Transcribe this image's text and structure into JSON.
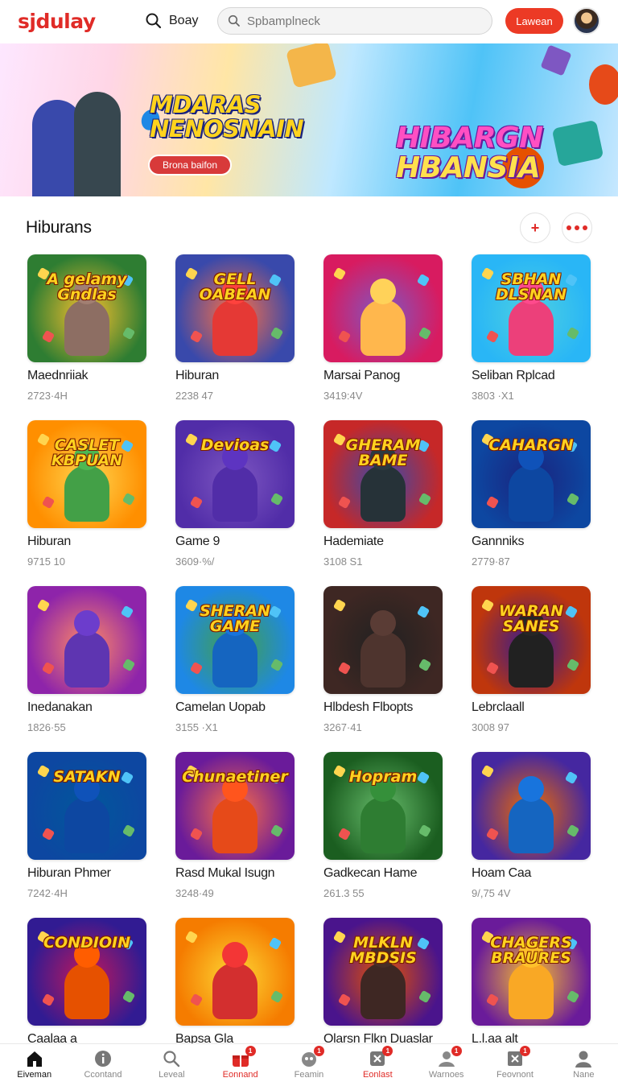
{
  "header": {
    "logo": "sjdulay",
    "search_toggle_label": "Boay",
    "search_placeholder": "Spbamplneck",
    "login_label": "Lawean"
  },
  "banner": {
    "headline_left": [
      "MDARAS",
      "NENOSNAIN"
    ],
    "headline_right": [
      "HIBARGN",
      "HBANSIA"
    ],
    "button_label": "Brona baifon"
  },
  "section": {
    "title": "Hiburans",
    "add_label": "+",
    "more_label": "more"
  },
  "games": [
    {
      "title": "Maednriiak",
      "meta": "2723·4H",
      "art": "A gelamy Gndlas",
      "bg": "#2e7d32",
      "bg2": "#fbc02d",
      "fig": "#8d6e63"
    },
    {
      "title": "Hiburan",
      "meta": "2238 47",
      "art": "GELL OABEAN",
      "bg": "#3949ab",
      "bg2": "#ff7043",
      "fig": "#e53935"
    },
    {
      "title": "Marsai Panog",
      "meta": "3419:4V",
      "art": "",
      "bg": "#d81b60",
      "bg2": "#7e57c2",
      "fig": "#ffb74d"
    },
    {
      "title": "Seliban Rplcad",
      "meta": "3803 ·X1",
      "art": "SBHAN DLSNAN",
      "bg": "#29b6f6",
      "bg2": "#4dd0e1",
      "fig": "#ec407a"
    },
    {
      "title": "Hiburan",
      "meta": "9715 10",
      "art": "CASLET KBPUAN",
      "bg": "#ff8f00",
      "bg2": "#ffd54f",
      "fig": "#43a047"
    },
    {
      "title": "Game 9",
      "meta": "3609·%/",
      "art": "Devioas",
      "bg": "#512da8",
      "bg2": "#7e57c2",
      "fig": "#512da8"
    },
    {
      "title": "Hademiate",
      "meta": "3108 S1",
      "art": "GHERAM BAME",
      "bg": "#c62828",
      "bg2": "#3949ab",
      "fig": "#263238"
    },
    {
      "title": "Gannniks",
      "meta": "2779·87",
      "art": "CAHARGN",
      "bg": "#0d47a1",
      "bg2": "#1a237e",
      "fig": "#0d47a1"
    },
    {
      "title": "Inedanakan",
      "meta": "1826·55",
      "art": "",
      "bg": "#8e24aa",
      "bg2": "#ff8a65",
      "fig": "#5e35b1"
    },
    {
      "title": "Camelan Uopab",
      "meta": "3155 ·X1",
      "art": "SHERAN GAME",
      "bg": "#1e88e5",
      "bg2": "#43a047",
      "fig": "#1565c0"
    },
    {
      "title": "Hlbdesh Flbopts",
      "meta": "3267·41",
      "art": "",
      "bg": "#3e2723",
      "bg2": "#212121",
      "fig": "#4e342e"
    },
    {
      "title": "Lebrclaall",
      "meta": "3008 97",
      "art": "WARAN SANES",
      "bg": "#bf360c",
      "bg2": "#311b92",
      "fig": "#212121"
    },
    {
      "title": "Hiburan Phmer",
      "meta": "7242·4H",
      "art": "SATAKN",
      "bg": "#0d47a1",
      "bg2": "#01579b",
      "fig": "#0d47a1"
    },
    {
      "title": "Rasd Mukal Isugn",
      "meta": "3248·49",
      "art": "Chunaetiner",
      "bg": "#6a1b9a",
      "bg2": "#ff7043",
      "fig": "#e64a19"
    },
    {
      "title": "Gadkecan Hame",
      "meta": "261.3 55",
      "art": "Hopram",
      "bg": "#1b5e20",
      "bg2": "#66bb6a",
      "fig": "#2e7d32"
    },
    {
      "title": "Hoam Caa",
      "meta": "9/,75 4V",
      "art": "",
      "bg": "#4527a0",
      "bg2": "#ef6c00",
      "fig": "#1565c0"
    },
    {
      "title": "Caalaa a",
      "meta": "",
      "art": "CONDIOIN",
      "bg": "#311b92",
      "bg2": "#c2185b",
      "fig": "#e65100"
    },
    {
      "title": "Bapsa Gla",
      "meta": "",
      "art": "",
      "bg": "#f57c00",
      "bg2": "#fdd835",
      "fig": "#d32f2f"
    },
    {
      "title": "Olarsn Flkn Duaslar",
      "meta": "",
      "art": "MLKLN MBDSIS",
      "bg": "#4a148c",
      "bg2": "#e65100",
      "fig": "#3e2723"
    },
    {
      "title": "L.l.aa alt",
      "meta": "",
      "art": "CHAGERS BRAURES",
      "bg": "#6a1b9a",
      "bg2": "#fbc02d",
      "fig": "#f9a825"
    }
  ],
  "nav": [
    {
      "label": "Eiveman",
      "icon": "home-icon",
      "badge": ""
    },
    {
      "label": "Ccontand",
      "icon": "info-icon",
      "badge": ""
    },
    {
      "label": "Leveal",
      "icon": "search-icon",
      "badge": ""
    },
    {
      "label": "Eonnand",
      "icon": "gift-icon",
      "badge": "1"
    },
    {
      "label": "Feamin",
      "icon": "game-icon",
      "badge": "1"
    },
    {
      "label": "Eonlast",
      "icon": "close-box-icon",
      "badge": "1"
    },
    {
      "label": "Warnoes",
      "icon": "users-icon",
      "badge": "1"
    },
    {
      "label": "Feovnont",
      "icon": "x-square-icon",
      "badge": "1"
    },
    {
      "label": "Nane",
      "icon": "profile-icon",
      "badge": ""
    }
  ],
  "colors": {
    "accent": "#e02b27",
    "meta_text": "#8a8a8a"
  }
}
